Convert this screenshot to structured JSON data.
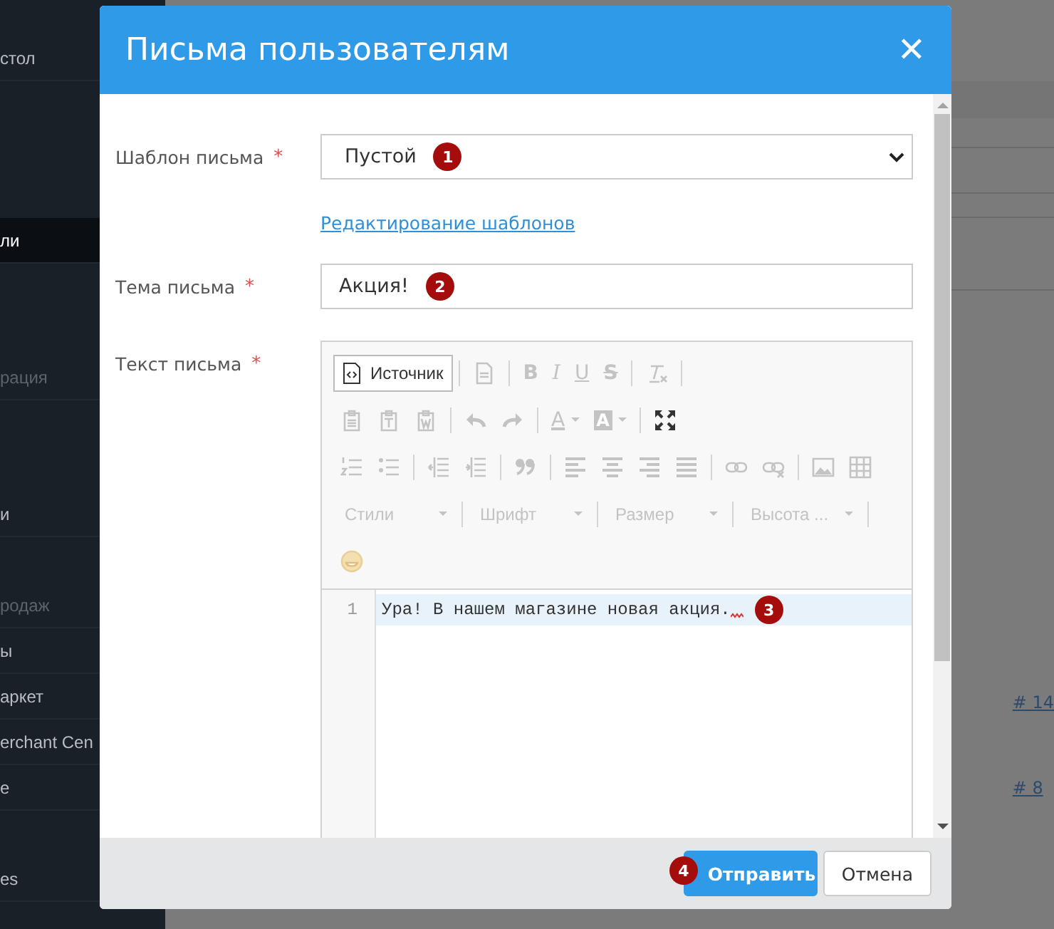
{
  "sidebar": {
    "items": [
      {
        "label": "стол",
        "kind": "item",
        "selected": false
      },
      {
        "label": "ли",
        "kind": "item",
        "selected": true
      },
      {
        "label": "рация",
        "kind": "header",
        "selected": false
      },
      {
        "label": "и",
        "kind": "item",
        "selected": false
      },
      {
        "label": "родаж",
        "kind": "header",
        "selected": false
      },
      {
        "label": "ы",
        "kind": "item",
        "selected": false
      },
      {
        "label": "аркет",
        "kind": "item",
        "selected": false
      },
      {
        "label": "erchant Cen",
        "kind": "item",
        "selected": false
      },
      {
        "label": "e",
        "kind": "item",
        "selected": false
      },
      {
        "label": "es",
        "kind": "item",
        "selected": false
      }
    ]
  },
  "page": {
    "links": [
      "# 14",
      "# 8"
    ]
  },
  "dialog": {
    "title": "Письма пользователям",
    "close": "✕",
    "template": {
      "label": "Шаблон письма",
      "required": "*",
      "value": "Пустой",
      "marker": "1"
    },
    "templates_link": "Редактирование шаблонов",
    "subject": {
      "label": "Тема письма",
      "required": "*",
      "value": "Акция!",
      "marker": "2"
    },
    "body": {
      "label": "Текст письма",
      "required": "*",
      "toolbar": [
        [
          {
            "kind": "source",
            "label": "Источник",
            "disabled": false
          },
          {
            "kind": "sep"
          },
          {
            "kind": "doc",
            "disabled": true
          },
          {
            "kind": "sep"
          },
          {
            "kind": "bold",
            "label": "B",
            "disabled": true
          },
          {
            "kind": "italic",
            "label": "I",
            "disabled": true
          },
          {
            "kind": "underline",
            "label": "U",
            "disabled": true
          },
          {
            "kind": "strike",
            "label": "S",
            "disabled": true
          },
          {
            "kind": "sep"
          },
          {
            "kind": "clear",
            "disabled": true
          },
          {
            "kind": "sep"
          }
        ],
        [
          {
            "kind": "paste",
            "disabled": true
          },
          {
            "kind": "pastetext",
            "disabled": true
          },
          {
            "kind": "pasteword",
            "disabled": true
          },
          {
            "kind": "sep"
          },
          {
            "kind": "undo",
            "disabled": true
          },
          {
            "kind": "redo",
            "disabled": true
          },
          {
            "kind": "sep"
          },
          {
            "kind": "textcolor",
            "label": "A",
            "disabled": true
          },
          {
            "kind": "bgcolor",
            "label": "A",
            "disabled": true
          },
          {
            "kind": "sep"
          },
          {
            "kind": "maximize",
            "disabled": false
          }
        ],
        [
          {
            "kind": "numlist",
            "disabled": true
          },
          {
            "kind": "bullist",
            "disabled": true
          },
          {
            "kind": "sep"
          },
          {
            "kind": "outdent",
            "disabled": true
          },
          {
            "kind": "indent",
            "disabled": true
          },
          {
            "kind": "sep"
          },
          {
            "kind": "quote",
            "disabled": true
          },
          {
            "kind": "sep"
          },
          {
            "kind": "left",
            "disabled": true
          },
          {
            "kind": "center",
            "disabled": true
          },
          {
            "kind": "right",
            "disabled": true
          },
          {
            "kind": "justify",
            "disabled": true
          },
          {
            "kind": "sep"
          },
          {
            "kind": "link",
            "disabled": true
          },
          {
            "kind": "unlink",
            "disabled": true
          },
          {
            "kind": "sep"
          },
          {
            "kind": "image",
            "disabled": true
          },
          {
            "kind": "table",
            "disabled": true
          }
        ],
        [
          {
            "kind": "combo",
            "label": "Стили",
            "disabled": true
          },
          {
            "kind": "sep"
          },
          {
            "kind": "combo",
            "label": "Шрифт",
            "disabled": true
          },
          {
            "kind": "sep"
          },
          {
            "kind": "combo",
            "label": "Размер",
            "disabled": true
          },
          {
            "kind": "sep"
          },
          {
            "kind": "combo",
            "label": "Высота ...",
            "disabled": true
          },
          {
            "kind": "sep"
          }
        ],
        [
          {
            "kind": "smiley",
            "disabled": true
          }
        ]
      ],
      "lines": [
        {
          "number": "1",
          "text": "Ура! В нашем магазине новая акция.",
          "active": true,
          "spell_error": true,
          "marker": "3"
        }
      ]
    },
    "buttons": [
      {
        "label": "Отправить",
        "kind": "primary",
        "marker": "4"
      },
      {
        "label": "Отмена",
        "kind": "default"
      }
    ]
  }
}
